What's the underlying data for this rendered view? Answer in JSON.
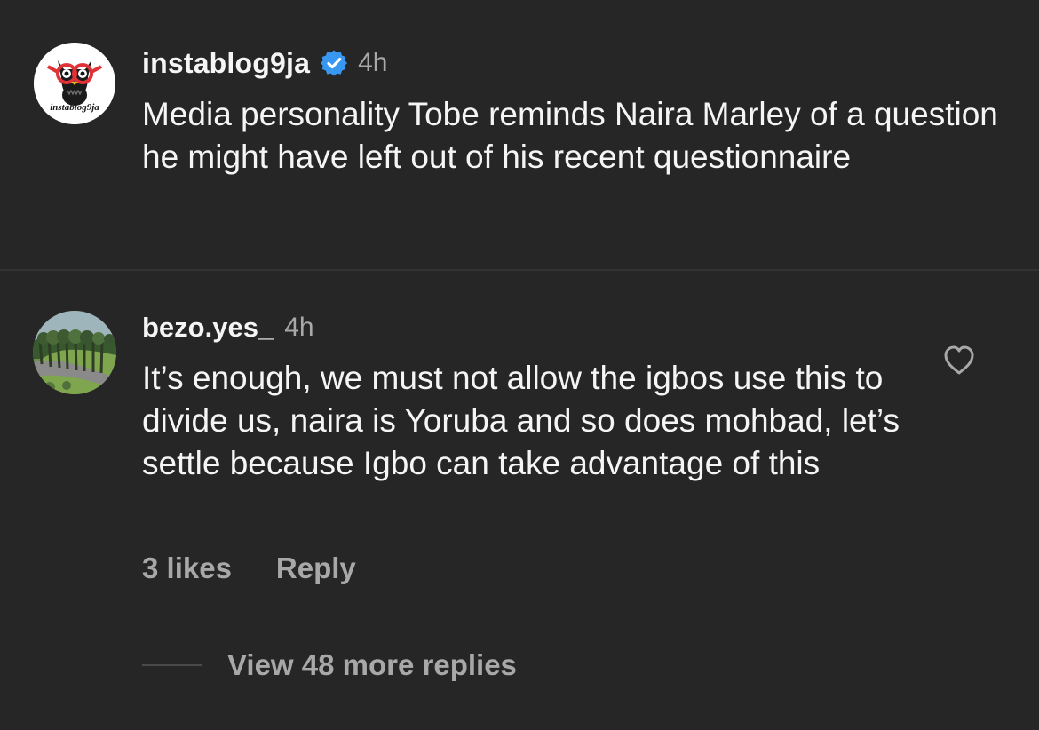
{
  "post": {
    "username": "instablog9ja",
    "avatar_text": "instablog9ja",
    "verified": true,
    "timestamp": "4h",
    "caption": "Media personality Tobe reminds Naira Marley of a question he might have left out of his recent questionnaire"
  },
  "comment": {
    "username": "bezo.yes_",
    "timestamp": "4h",
    "text": "It’s enough, we must not allow the igbos use this to divide us, naira is Yoruba and so does mohbad, let’s settle because Igbo can take advantage of this",
    "likes_label": "3 likes",
    "reply_label": "Reply",
    "view_replies_label": "View 48 more replies",
    "like_icon": "heart-icon"
  },
  "colors": {
    "background": "#262626",
    "primary_text": "#f5f5f5",
    "secondary_text": "#a8a8a8",
    "verified_blue": "#3897f0"
  }
}
